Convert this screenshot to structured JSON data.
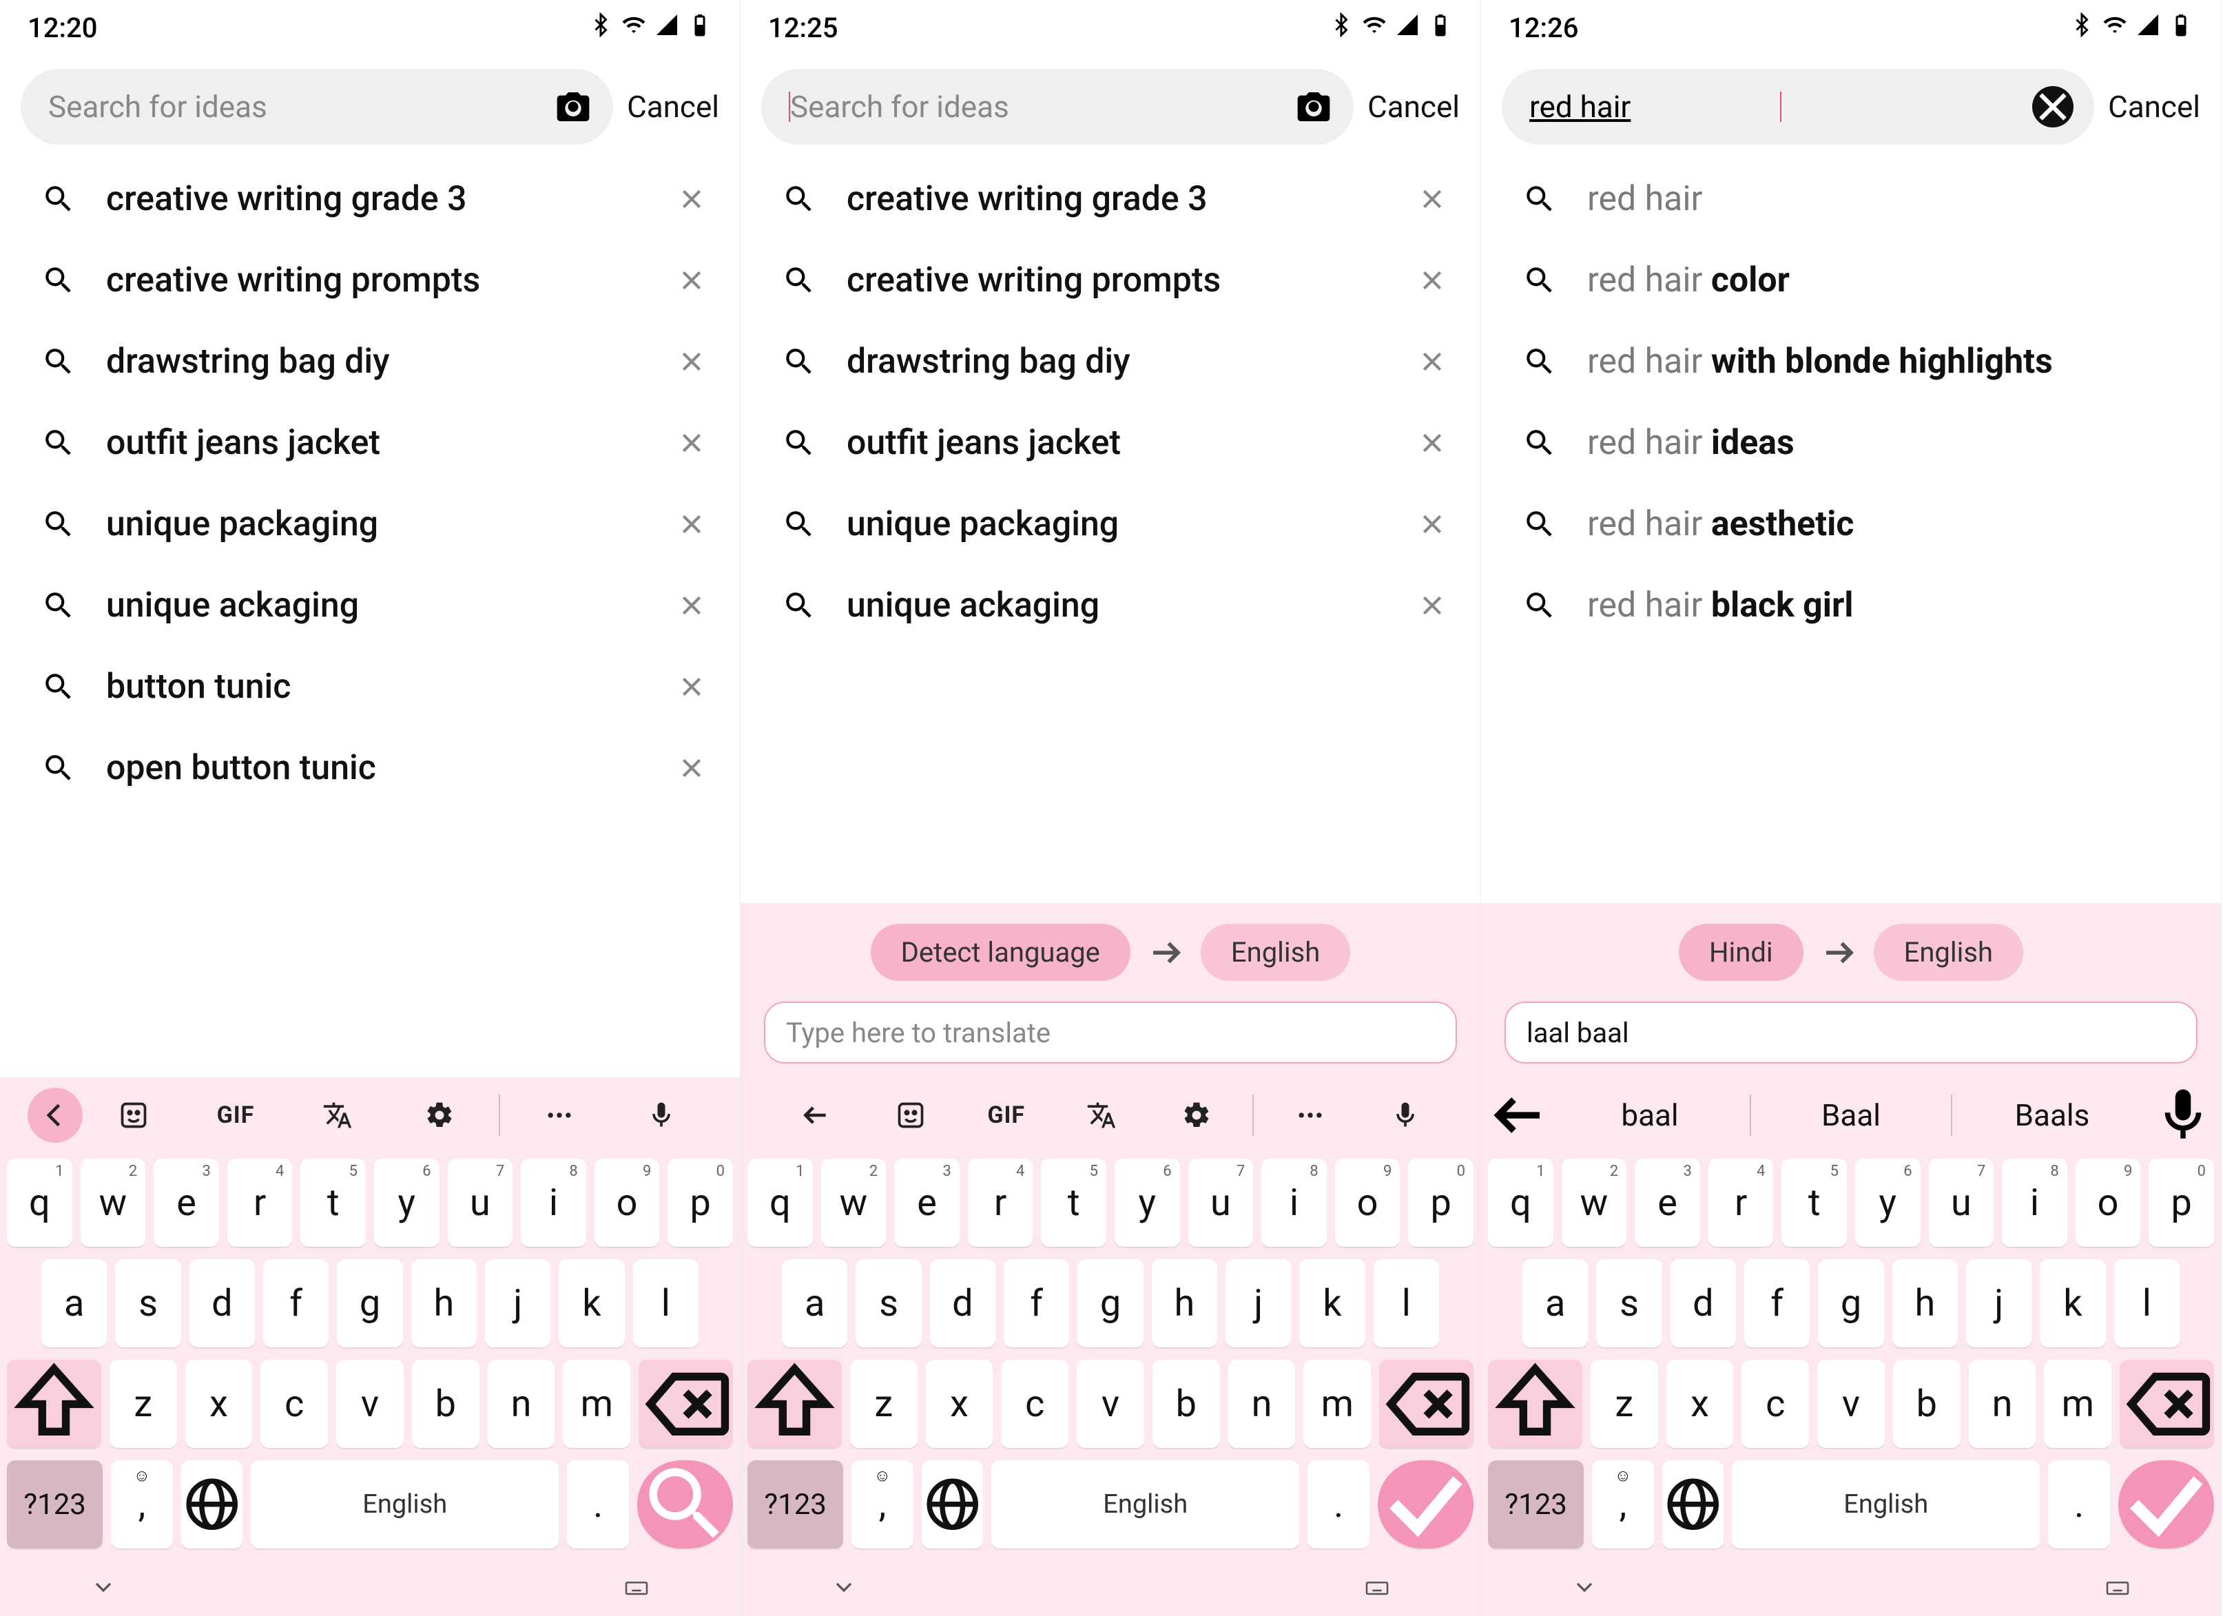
{
  "screens": [
    {
      "status_time": "12:20",
      "search_placeholder": "Search for ideas",
      "search_value": "",
      "has_camera": true,
      "has_clear": false,
      "cancel": "Cancel",
      "suggestions": [
        {
          "text": "creative writing grade 3",
          "removable": true
        },
        {
          "text": "creative writing prompts",
          "removable": true
        },
        {
          "text": "drawstring bag diy",
          "removable": true
        },
        {
          "text": "outfit jeans jacket",
          "removable": true
        },
        {
          "text": "unique packaging",
          "removable": true
        },
        {
          "text": "unique ackaging",
          "removable": true
        },
        {
          "text": "button tunic",
          "removable": true
        },
        {
          "text": "open button tunic",
          "removable": true
        }
      ],
      "translate_bar": null,
      "kb_toolbar": true,
      "predictions": null,
      "enter_icon": "search",
      "toolbar_back_circle": true
    },
    {
      "status_time": "12:25",
      "search_placeholder": "Search for ideas",
      "search_value": "",
      "show_cursor": true,
      "has_camera": true,
      "has_clear": false,
      "cancel": "Cancel",
      "suggestions": [
        {
          "text": "creative writing grade 3",
          "removable": true
        },
        {
          "text": "creative writing prompts",
          "removable": true
        },
        {
          "text": "drawstring bag diy",
          "removable": true
        },
        {
          "text": "outfit jeans jacket",
          "removable": true
        },
        {
          "text": "unique packaging",
          "removable": true
        },
        {
          "text": "unique ackaging",
          "removable": true
        }
      ],
      "translate_bar": {
        "from": "Detect language",
        "to": "English",
        "input_placeholder": "Type here to translate",
        "input_value": ""
      },
      "kb_toolbar": true,
      "predictions": null,
      "enter_icon": "check",
      "toolbar_back_circle": false
    },
    {
      "status_time": "12:26",
      "search_placeholder": "",
      "search_value": "red hair",
      "show_cursor_after": true,
      "has_camera": false,
      "has_clear": true,
      "cancel": "Cancel",
      "suggestions": [
        {
          "prefix": "red hair",
          "suffix": "",
          "removable": false
        },
        {
          "prefix": "red hair ",
          "suffix": "color",
          "removable": false
        },
        {
          "prefix": "red hair ",
          "suffix": "with blonde highlights",
          "removable": false
        },
        {
          "prefix": "red hair ",
          "suffix": "ideas",
          "removable": false
        },
        {
          "prefix": "red hair ",
          "suffix": "aesthetic",
          "removable": false
        },
        {
          "prefix": "red hair ",
          "suffix": "black girl",
          "removable": false
        }
      ],
      "translate_bar": {
        "from": "Hindi",
        "to": "English",
        "input_placeholder": "",
        "input_value": "laal baal"
      },
      "kb_toolbar": false,
      "predictions": {
        "items": [
          "baal",
          "Baal",
          "Baals"
        ],
        "active": 0
      },
      "enter_icon": "check",
      "toolbar_back_circle": false
    }
  ],
  "keyboard": {
    "row1": [
      "q",
      "w",
      "e",
      "r",
      "t",
      "y",
      "u",
      "i",
      "o",
      "p"
    ],
    "row1_super": [
      "1",
      "2",
      "3",
      "4",
      "5",
      "6",
      "7",
      "8",
      "9",
      "0"
    ],
    "row2": [
      "a",
      "s",
      "d",
      "f",
      "g",
      "h",
      "j",
      "k",
      "l"
    ],
    "row3": [
      "z",
      "x",
      "c",
      "v",
      "b",
      "n",
      "m"
    ],
    "numkey": "?123",
    "space": "English",
    "dot": ".",
    "comma": ","
  },
  "toolbar_gif": "GIF"
}
